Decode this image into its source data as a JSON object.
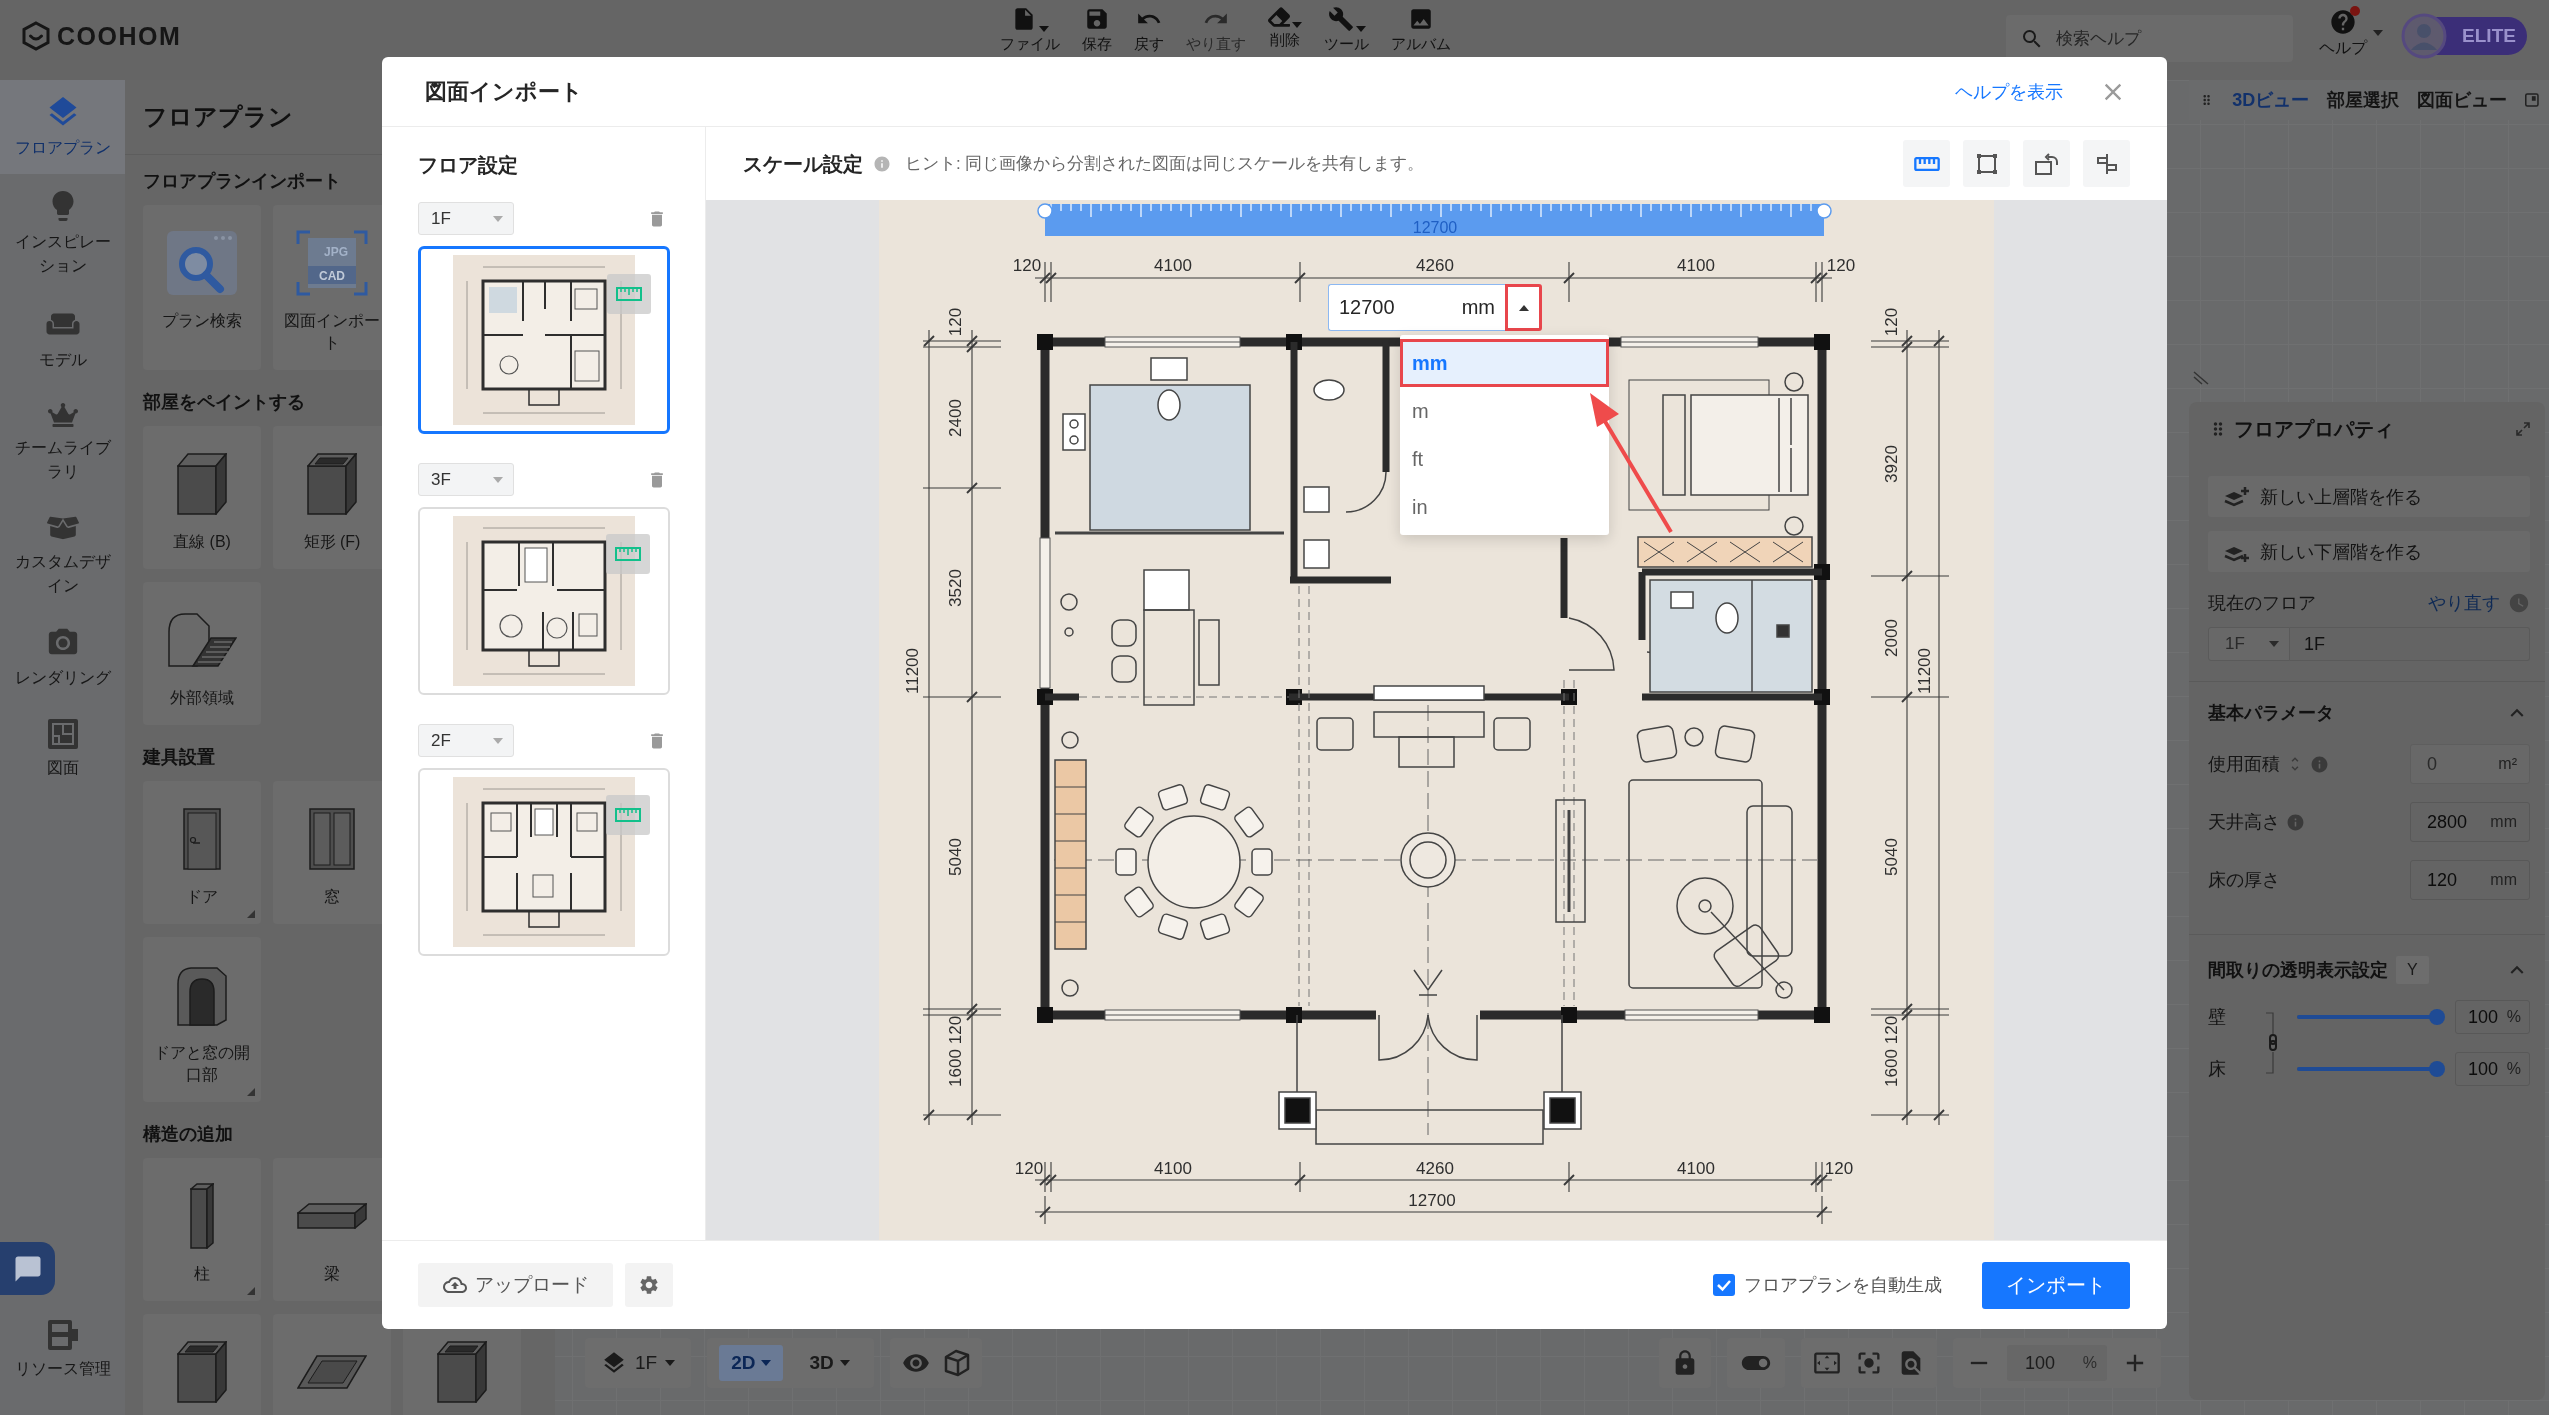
{
  "header": {
    "logo": "COOHOM",
    "menu": [
      {
        "label": "ファイル",
        "has_menu": true,
        "disabled": false
      },
      {
        "label": "保存",
        "has_menu": false,
        "disabled": false
      },
      {
        "label": "戻す",
        "has_menu": false,
        "disabled": false
      },
      {
        "label": "やり直す",
        "has_menu": false,
        "disabled": true
      },
      {
        "label": "削除",
        "has_menu": true,
        "disabled": false
      },
      {
        "label": "ツール",
        "has_menu": true,
        "disabled": false
      },
      {
        "label": "アルバム",
        "has_menu": false,
        "disabled": false
      }
    ],
    "search": {
      "placeholder": "検索ヘルプ"
    },
    "help": {
      "label": "ヘルプ",
      "notification": true
    },
    "plan_badge": "ELITE"
  },
  "sidebar": {
    "items": [
      {
        "label": "フロアプラン",
        "selected": true
      },
      {
        "label": "インスピレーション",
        "selected": false
      },
      {
        "label": "モデル",
        "selected": false
      },
      {
        "label": "チームライブラリ",
        "selected": false
      },
      {
        "label": "カスタムデザイン",
        "selected": false
      },
      {
        "label": "レンダリング",
        "selected": false
      },
      {
        "label": "図面",
        "selected": false
      }
    ],
    "footer_item": {
      "label": "リソース管理"
    }
  },
  "panel": {
    "title": "フロアプラン",
    "groups": [
      {
        "title": "フロアプランインポート",
        "rows": [
          [
            {
              "label": "プラン検索",
              "expandable": false
            },
            {
              "label": "図面インポート",
              "expandable": false,
              "file_types": [
                "JPG",
                "CAD"
              ]
            }
          ]
        ]
      },
      {
        "title": "部屋をペイントする",
        "rows": [
          [
            {
              "label": "直線 (B)",
              "expandable": false
            },
            {
              "label": "矩形 (F)",
              "expandable": false
            }
          ],
          [
            {
              "label": "外部領域",
              "expandable": false
            }
          ]
        ]
      },
      {
        "title": "建具設置",
        "rows": [
          [
            {
              "label": "ドア",
              "expandable": true
            },
            {
              "label": "窓",
              "expandable": false
            }
          ],
          [
            {
              "label": "ドアと窓の開口部",
              "expandable": true
            }
          ]
        ]
      },
      {
        "title": "構造の追加",
        "rows": [
          [
            {
              "label": "柱",
              "expandable": true
            },
            {
              "label": "梁",
              "expandable": false
            }
          ],
          [
            {
              "expandable": false
            },
            {
              "expandable": false
            },
            {
              "expandable": false
            }
          ]
        ]
      }
    ]
  },
  "view_tabs": [
    {
      "label": "3Dビュー",
      "selected": true
    },
    {
      "label": "部屋選択",
      "selected": false
    },
    {
      "label": "図面ビュー",
      "selected": false
    }
  ],
  "floor_properties": {
    "title": "フロアプロパティ",
    "actions": [
      "新しい上層階を作る",
      "新しい下層階を作る"
    ],
    "current_floor": {
      "label": "現在のフロア",
      "reset": "やり直す",
      "floor": "1F",
      "floor_select_disabled": true,
      "name": "1F"
    },
    "basic": {
      "title": "基本パラメータ",
      "expanded": true,
      "fields": [
        {
          "label": "使用面積",
          "value": "0",
          "unit": "m²",
          "disabled": true,
          "sortable": true,
          "info": true
        },
        {
          "label": "天井高さ",
          "value": "2800",
          "unit": "mm",
          "disabled": false,
          "sortable": false,
          "info": true
        },
        {
          "label": "床の厚さ",
          "value": "120",
          "unit": "mm",
          "disabled": false,
          "sortable": false,
          "info": false
        }
      ]
    },
    "transparency": {
      "title": "間取りの透明表示設定",
      "shortcut": "Y",
      "expanded": true,
      "linked": true,
      "sliders": [
        {
          "label": "壁",
          "level": 1,
          "value": "100",
          "unit": "%"
        },
        {
          "label": "床",
          "level": 1,
          "value": "100",
          "unit": "%"
        }
      ]
    }
  },
  "bottom_toolbar": {
    "floor": "1F",
    "view_modes": [
      {
        "label": "2D",
        "selected": true
      },
      {
        "label": "3D",
        "selected": false
      }
    ],
    "zoom": "100",
    "zoom_unit": "%"
  },
  "dialog": {
    "title": "図面インポート",
    "help_link": "ヘルプを表示",
    "floor_settings": {
      "title": "フロア設定",
      "floors": [
        {
          "floor": "1F",
          "selected": true,
          "scale_set": true
        },
        {
          "floor": "3F",
          "selected": false,
          "scale_set": true
        },
        {
          "floor": "2F",
          "selected": false,
          "scale_set": true
        }
      ]
    },
    "scale_settings": {
      "title": "スケール設定",
      "hint": "ヒント: 同じ画像から分割された図面は同じスケールを共有します。",
      "tools": [
        {
          "selected": true
        },
        {
          "selected": false
        },
        {
          "selected": false
        },
        {
          "selected": false
        }
      ],
      "ruler_label": "12700",
      "length": {
        "value": "12700",
        "unit": "mm",
        "expanded": true,
        "highlighted": true
      },
      "unit_options": [
        {
          "label": "mm",
          "selected": true,
          "highlighted": true
        },
        {
          "label": "m",
          "selected": false,
          "highlighted": false
        },
        {
          "label": "ft",
          "selected": false,
          "highlighted": false
        },
        {
          "label": "in",
          "selected": false,
          "highlighted": false
        }
      ],
      "floor_plan": {
        "top_dimensions": [
          "120",
          "4100",
          "4260",
          "4100",
          "120"
        ],
        "left_dimensions": [
          "120",
          "2400",
          "3520",
          "5040",
          "120",
          "1600"
        ],
        "left_total": "11200",
        "right_dimensions": [
          "120",
          "3920",
          "2000",
          "5040",
          "120",
          "1600"
        ],
        "right_total": "11200",
        "bottom_dimensions": [
          "120",
          "4100",
          "4260",
          "4100",
          "120"
        ],
        "bottom_total": "12700"
      }
    },
    "footer": {
      "upload": "アップロード",
      "auto_generate": {
        "label": "フロアプランを自動生成",
        "checked": true
      },
      "import": "インポート"
    }
  }
}
